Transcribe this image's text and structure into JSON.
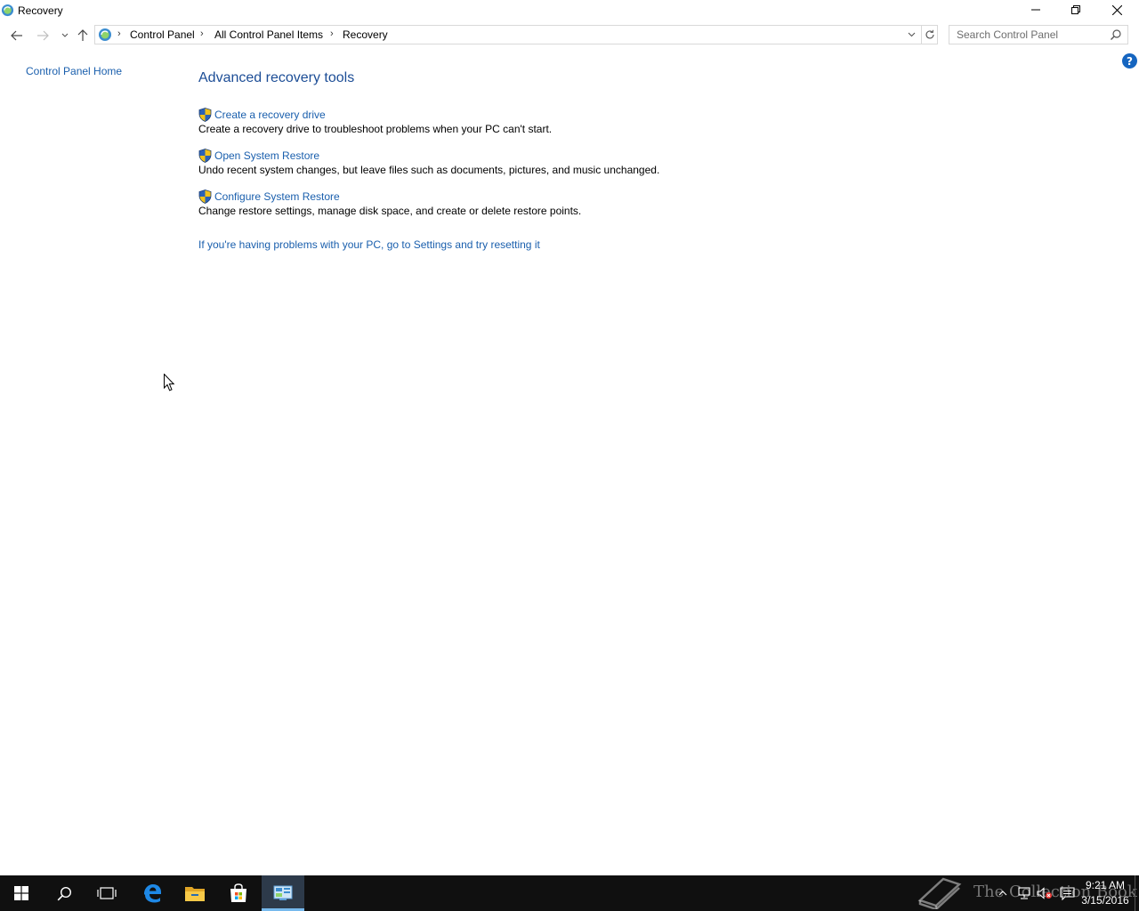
{
  "window": {
    "title": "Recovery"
  },
  "address": {
    "breadcrumbs": [
      "Control Panel",
      "All Control Panel Items",
      "Recovery"
    ]
  },
  "search": {
    "placeholder": "Search Control Panel"
  },
  "left_pane": {
    "home_link": "Control Panel Home"
  },
  "content": {
    "heading": "Advanced recovery tools",
    "tasks": [
      {
        "label": "Create a recovery drive",
        "description": "Create a recovery drive to troubleshoot problems when your PC can't start."
      },
      {
        "label": "Open System Restore",
        "description": "Undo recent system changes, but leave files such as documents, pictures, and music unchanged."
      },
      {
        "label": "Configure System Restore",
        "description": "Change restore settings, manage disk space, and create or delete restore points."
      }
    ],
    "reset_link": "If you're having problems with your PC, go to Settings and try resetting it"
  },
  "help": {
    "glyph": "?"
  },
  "watermark": {
    "text": "The Collection Book"
  },
  "taskbar": {
    "apps": [
      "windows-start-icon",
      "search-icon",
      "task-view-icon",
      "edge-icon",
      "file-explorer-icon",
      "store-icon",
      "control-panel-icon"
    ],
    "clock": {
      "time": "9:21 AM",
      "date": "3/15/2016"
    }
  },
  "colors": {
    "link": "#1a5fad",
    "heading": "#1c4d96",
    "taskbar": "#101010",
    "active_app_underline": "#76b9ed",
    "help": "#1565c0"
  }
}
